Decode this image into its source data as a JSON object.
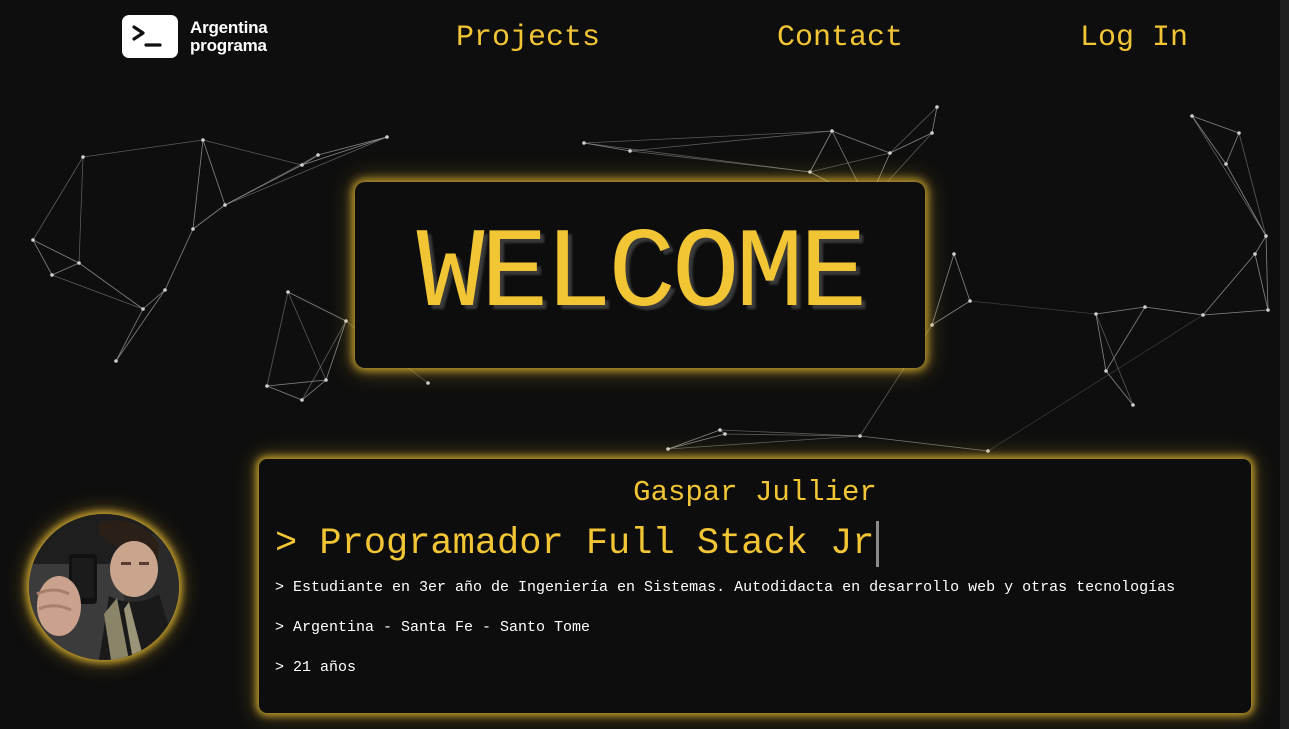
{
  "header": {
    "logo": {
      "line1": "Argentina",
      "line2": "programa",
      "icon": "terminal-prompt-icon"
    },
    "nav": {
      "projects": "Projects",
      "contact": "Contact",
      "login": "Log In"
    }
  },
  "hero": {
    "welcome": "WELCOME"
  },
  "profile": {
    "name": "Gaspar Jullier",
    "role": "> Programador Full Stack Jr",
    "lines": [
      "> Estudiante en 3er año de Ingeniería en Sistemas. Autodidacta en desarrollo web y otras tecnologías",
      "> Argentina - Santa Fe - Santo Tome",
      "> 21 años"
    ]
  },
  "colors": {
    "accent": "#f2c535",
    "background": "#0e0e0e",
    "card": "#0d0d0d",
    "text": "#ffffff"
  }
}
